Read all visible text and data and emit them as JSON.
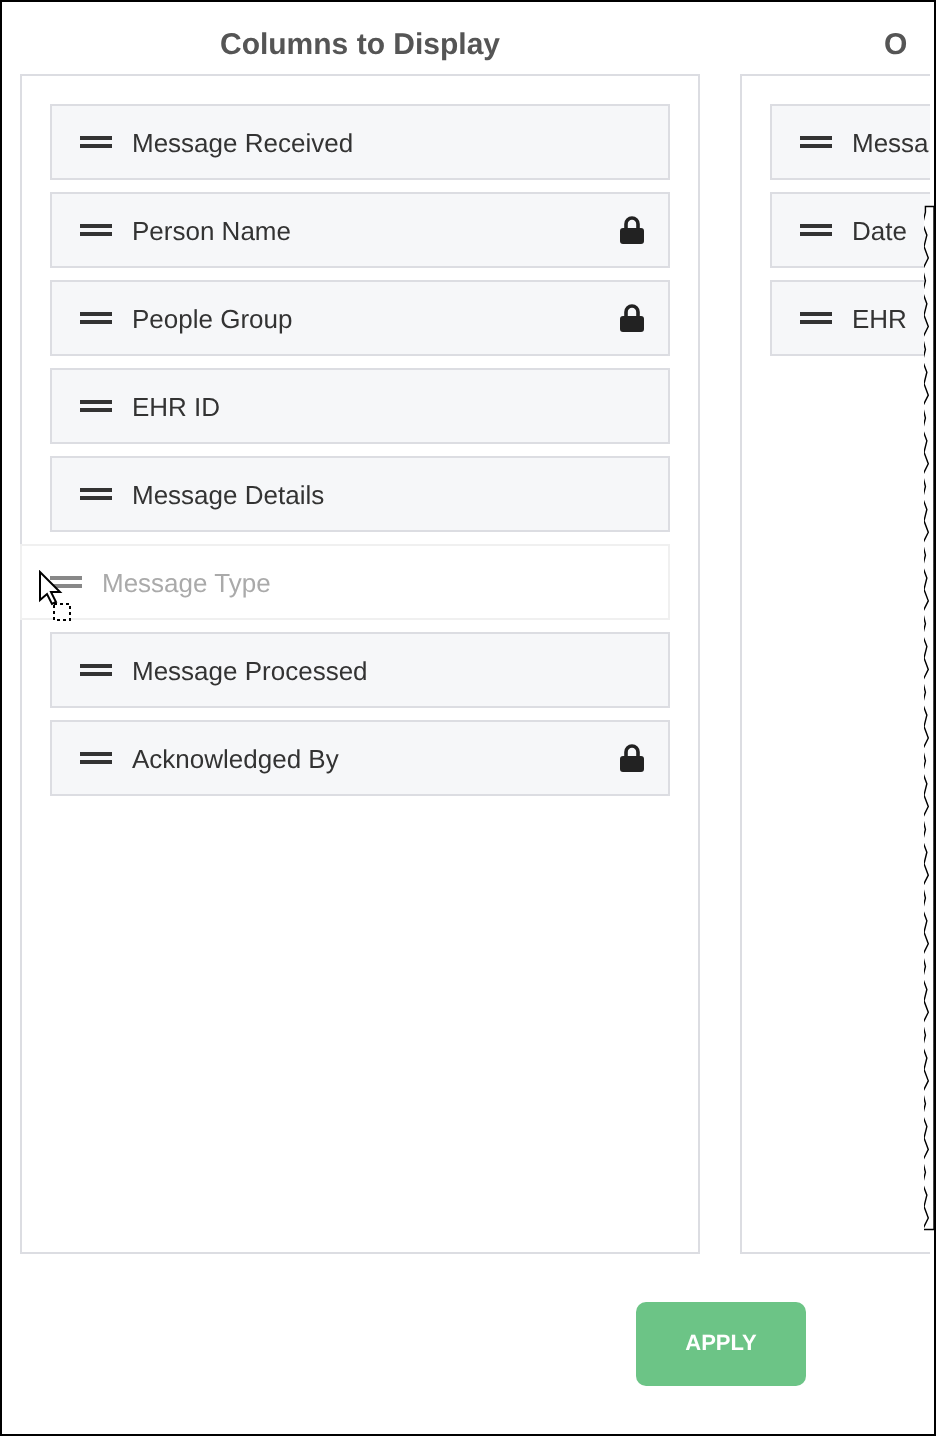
{
  "columns": [
    {
      "title": "Columns to Display",
      "items": [
        {
          "label": "Message Received",
          "locked": false,
          "kind": "normal"
        },
        {
          "label": "Person Name",
          "locked": true,
          "kind": "normal"
        },
        {
          "label": "People Group",
          "locked": true,
          "kind": "normal"
        },
        {
          "label": "EHR ID",
          "locked": false,
          "kind": "normal"
        },
        {
          "label": "Message Details",
          "locked": false,
          "kind": "normal"
        },
        {
          "label": "Message Type",
          "locked": false,
          "kind": "dragging"
        },
        {
          "label": "Message Processed",
          "locked": false,
          "kind": "normal"
        },
        {
          "label": "Acknowledged By",
          "locked": true,
          "kind": "normal"
        }
      ]
    },
    {
      "title": "O",
      "items": [
        {
          "label": "Messa",
          "locked": false,
          "kind": "normal"
        },
        {
          "label": "Date",
          "locked": false,
          "kind": "normal"
        },
        {
          "label": "EHR",
          "locked": false,
          "kind": "normal"
        }
      ]
    }
  ],
  "apply_button": "APPLY"
}
